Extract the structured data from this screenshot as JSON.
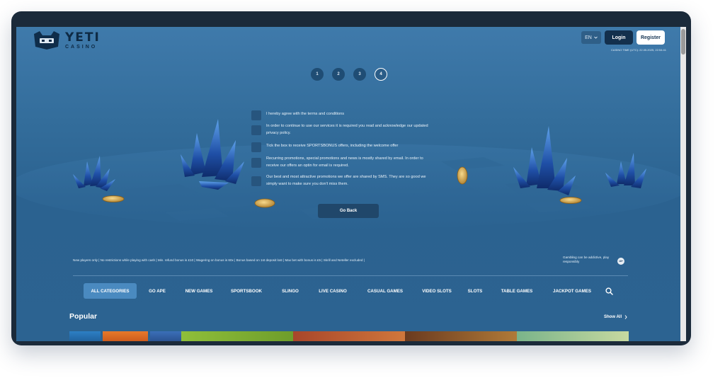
{
  "header": {
    "logo_name": "YETI",
    "logo_sub": "CASINO",
    "language": "EN",
    "login_label": "Login",
    "register_label": "Register",
    "casino_time": "CASINO TIME (UTC): 22.05.2025, 22:54:41"
  },
  "steps": [
    "1",
    "2",
    "3",
    "4"
  ],
  "active_step": "4",
  "consents": [
    "I hereby agree with the terms and conditions",
    "In order to continue to use our services it is required you read and acknowledge our updated privacy policy.",
    "Tick the box to receive SPORTSBONUS offers, including the welcome offer",
    "Recurring promotions, special promotions and news is mostly shared by email. In order to receive our offers an optin for email is required.",
    "Our best and most attractive promotions we offer are shared by SMS. They are so good we simply want to make sure you don't miss them."
  ],
  "go_back_label": "Go Back",
  "disclaimer": "New players only | No restrictions while playing with cash | Min. refund bonus is £10 | Wagering on bonus is 60x | Bonus based on 1st deposit lost | Max bet with bonus is £5 | Skrill and Neteller excluded |",
  "gambling_note": "Gambling can be addictive, play responsibly",
  "age_badge": "18+",
  "categories": [
    "ALL CATEGORIES",
    "GO APE",
    "NEW GAMES",
    "SPORTSBOOK",
    "SLINGO",
    "LIVE CASINO",
    "CASUAL GAMES",
    "VIDEO SLOTS",
    "SLOTS",
    "TABLE GAMES",
    "JACKPOT GAMES"
  ],
  "active_category": "ALL CATEGORIES",
  "popular": {
    "title": "Popular",
    "show_all_label": "Show All"
  },
  "colors": {
    "background": "#336d9b",
    "accent": "#4a8ac0",
    "dark_button": "#13304d"
  }
}
